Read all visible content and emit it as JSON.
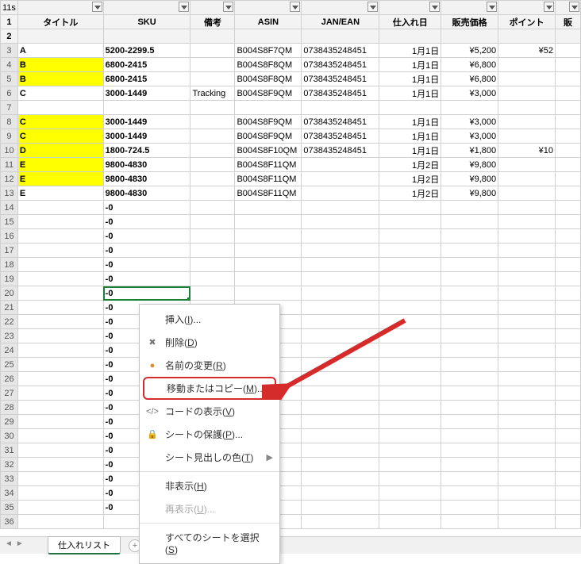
{
  "name_box": "11s",
  "headers": {
    "a": "タイトル",
    "b": "SKU",
    "c": "備考",
    "d": "ASIN",
    "e": "JAN/EAN",
    "f": "仕入れ日",
    "g": "販売価格",
    "h": "ポイント",
    "i": "販"
  },
  "rows": [
    {
      "n": 3,
      "a": "A",
      "b": "5200-2299.5",
      "c": "",
      "d": "B004S8F7QM",
      "e": "0738435248451",
      "f": "1月1日",
      "g": "¥5,200",
      "h": "¥52",
      "hl": false
    },
    {
      "n": 4,
      "a": "B",
      "b": "6800-2415",
      "c": "",
      "d": "B004S8F8QM",
      "e": "0738435248451",
      "f": "1月1日",
      "g": "¥6,800",
      "h": "",
      "hl": true
    },
    {
      "n": 5,
      "a": "B",
      "b": "6800-2415",
      "c": "",
      "d": "B004S8F8QM",
      "e": "0738435248451",
      "f": "1月1日",
      "g": "¥6,800",
      "h": "",
      "hl": true
    },
    {
      "n": 6,
      "a": "C",
      "b": "3000-1449",
      "c": "Tracking",
      "d": "B004S8F9QM",
      "e": "0738435248451",
      "f": "1月1日",
      "g": "¥3,000",
      "h": "",
      "hl": false
    },
    {
      "n": 7,
      "a": "",
      "b": "",
      "c": "",
      "d": "",
      "e": "",
      "f": "",
      "g": "",
      "h": "",
      "hl": false
    },
    {
      "n": 8,
      "a": "C",
      "b": "3000-1449",
      "c": "",
      "d": "B004S8F9QM",
      "e": "0738435248451",
      "f": "1月1日",
      "g": "¥3,000",
      "h": "",
      "hl": true
    },
    {
      "n": 9,
      "a": "C",
      "b": "3000-1449",
      "c": "",
      "d": "B004S8F9QM",
      "e": "0738435248451",
      "f": "1月1日",
      "g": "¥3,000",
      "h": "",
      "hl": true
    },
    {
      "n": 10,
      "a": "D",
      "b": "1800-724.5",
      "c": "",
      "d": "B004S8F10QM",
      "e": "0738435248451",
      "f": "1月1日",
      "g": "¥1,800",
      "h": "¥10",
      "hl": true
    },
    {
      "n": 11,
      "a": "E",
      "b": "9800-4830",
      "c": "",
      "d": "B004S8F11QM",
      "e": "",
      "f": "1月2日",
      "g": "¥9,800",
      "h": "",
      "hl": true
    },
    {
      "n": 12,
      "a": "E",
      "b": "9800-4830",
      "c": "",
      "d": "B004S8F11QM",
      "e": "",
      "f": "1月2日",
      "g": "¥9,800",
      "h": "",
      "hl": true
    },
    {
      "n": 13,
      "a": "E",
      "b": "9800-4830",
      "c": "",
      "d": "B004S8F11QM",
      "e": "",
      "f": "1月2日",
      "g": "¥9,800",
      "h": "",
      "hl": false
    },
    {
      "n": 14,
      "a": "",
      "b": "-0",
      "c": "",
      "d": "",
      "e": "",
      "f": "",
      "g": "",
      "h": "",
      "hl": false
    },
    {
      "n": 15,
      "a": "",
      "b": "-0",
      "c": "",
      "d": "",
      "e": "",
      "f": "",
      "g": "",
      "h": "",
      "hl": false
    },
    {
      "n": 16,
      "a": "",
      "b": "-0",
      "c": "",
      "d": "",
      "e": "",
      "f": "",
      "g": "",
      "h": "",
      "hl": false
    },
    {
      "n": 17,
      "a": "",
      "b": "-0",
      "c": "",
      "d": "",
      "e": "",
      "f": "",
      "g": "",
      "h": "",
      "hl": false
    },
    {
      "n": 18,
      "a": "",
      "b": "-0",
      "c": "",
      "d": "",
      "e": "",
      "f": "",
      "g": "",
      "h": "",
      "hl": false
    },
    {
      "n": 19,
      "a": "",
      "b": "-0",
      "c": "",
      "d": "",
      "e": "",
      "f": "",
      "g": "",
      "h": "",
      "hl": false
    },
    {
      "n": 20,
      "a": "",
      "b": "-0",
      "c": "",
      "d": "",
      "e": "",
      "f": "",
      "g": "",
      "h": "",
      "hl": false,
      "sel": true
    },
    {
      "n": 21,
      "a": "",
      "b": "-0",
      "c": "",
      "d": "",
      "e": "",
      "f": "",
      "g": "",
      "h": "",
      "hl": false
    },
    {
      "n": 22,
      "a": "",
      "b": "-0",
      "c": "",
      "d": "",
      "e": "",
      "f": "",
      "g": "",
      "h": "",
      "hl": false
    },
    {
      "n": 23,
      "a": "",
      "b": "-0",
      "c": "",
      "d": "",
      "e": "",
      "f": "",
      "g": "",
      "h": "",
      "hl": false
    },
    {
      "n": 24,
      "a": "",
      "b": "-0",
      "c": "",
      "d": "",
      "e": "",
      "f": "",
      "g": "",
      "h": "",
      "hl": false
    },
    {
      "n": 25,
      "a": "",
      "b": "-0",
      "c": "",
      "d": "",
      "e": "",
      "f": "",
      "g": "",
      "h": "",
      "hl": false
    },
    {
      "n": 26,
      "a": "",
      "b": "-0",
      "c": "",
      "d": "",
      "e": "",
      "f": "",
      "g": "",
      "h": "",
      "hl": false
    },
    {
      "n": 27,
      "a": "",
      "b": "-0",
      "c": "",
      "d": "",
      "e": "",
      "f": "",
      "g": "",
      "h": "",
      "hl": false
    },
    {
      "n": 28,
      "a": "",
      "b": "-0",
      "c": "",
      "d": "",
      "e": "",
      "f": "",
      "g": "",
      "h": "",
      "hl": false
    },
    {
      "n": 29,
      "a": "",
      "b": "-0",
      "c": "",
      "d": "",
      "e": "",
      "f": "",
      "g": "",
      "h": "",
      "hl": false
    },
    {
      "n": 30,
      "a": "",
      "b": "-0",
      "c": "",
      "d": "",
      "e": "",
      "f": "",
      "g": "",
      "h": "",
      "hl": false
    },
    {
      "n": 31,
      "a": "",
      "b": "-0",
      "c": "",
      "d": "",
      "e": "",
      "f": "",
      "g": "",
      "h": "",
      "hl": false
    },
    {
      "n": 32,
      "a": "",
      "b": "-0",
      "c": "",
      "d": "",
      "e": "",
      "f": "",
      "g": "",
      "h": "",
      "hl": false
    },
    {
      "n": 33,
      "a": "",
      "b": "-0",
      "c": "",
      "d": "",
      "e": "",
      "f": "",
      "g": "",
      "h": "",
      "hl": false
    },
    {
      "n": 34,
      "a": "",
      "b": "-0",
      "c": "",
      "d": "",
      "e": "",
      "f": "",
      "g": "",
      "h": "",
      "hl": false
    },
    {
      "n": 35,
      "a": "",
      "b": "-0",
      "c": "",
      "d": "",
      "e": "",
      "f": "",
      "g": "",
      "h": "",
      "hl": false
    },
    {
      "n": 36,
      "a": "",
      "b": "",
      "c": "",
      "d": "",
      "e": "",
      "f": "",
      "g": "",
      "h": "",
      "hl": false
    }
  ],
  "tab": {
    "active": "仕入れリスト",
    "add": "+"
  },
  "menu": {
    "insert": "挿入",
    "insert_k": "I",
    "delete": "削除",
    "delete_k": "D",
    "rename": "名前の変更",
    "rename_k": "R",
    "move": "移動またはコピー",
    "move_k": "M",
    "code": "コードの表示",
    "code_k": "V",
    "protect": "シートの保護",
    "protect_k": "P",
    "tabcolor": "シート見出しの色",
    "tabcolor_k": "T",
    "hide": "非表示",
    "hide_k": "H",
    "unhide": "再表示",
    "unhide_k": "U",
    "selectall": "すべてのシートを選択",
    "selectall_k": "S"
  }
}
